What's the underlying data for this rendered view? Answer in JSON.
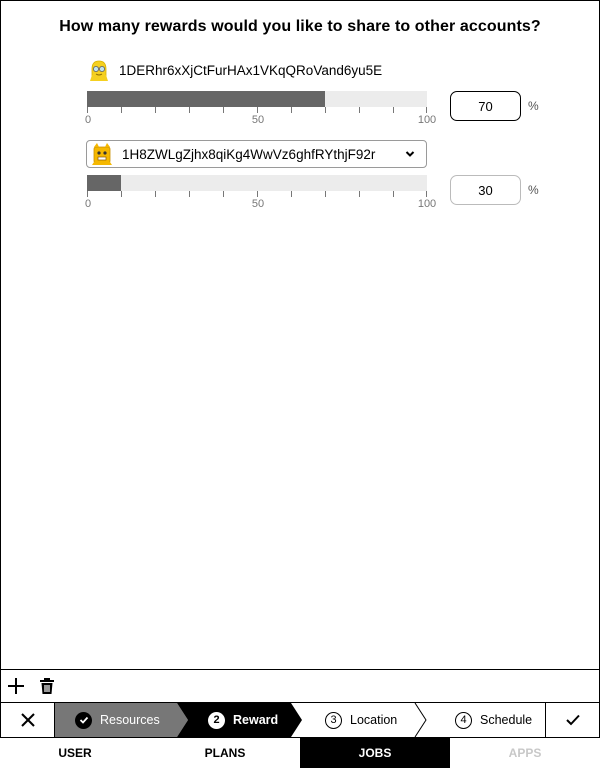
{
  "prompt": "How many rewards would you like to share to other accounts?",
  "accounts": [
    {
      "address": "1DERhr6xXjCtFurHAx1VKqQRoVand6yu5E",
      "value": "70",
      "fraction": 0.7,
      "avatar_icon": "yellow-face-glasses-icon"
    },
    {
      "address": "1H8ZWLgZjhx8qiKg4WwVz6ghfRYthjF92r",
      "value": "30",
      "fraction": 0.1,
      "avatar_icon": "yellow-monster-icon"
    }
  ],
  "scale": {
    "min": "0",
    "mid": "50",
    "max": "100"
  },
  "percent_sign": "%",
  "toolbar": {
    "add_icon": "plus-icon",
    "delete_icon": "trash-icon"
  },
  "steps": [
    {
      "num": "",
      "label": "Resources",
      "state": "done"
    },
    {
      "num": "2",
      "label": "Reward",
      "state": "current"
    },
    {
      "num": "3",
      "label": "Location",
      "state": "todo"
    },
    {
      "num": "4",
      "label": "Schedule",
      "state": "todo"
    }
  ],
  "tabs": [
    {
      "label": "USER",
      "state": "normal"
    },
    {
      "label": "PLANS",
      "state": "normal"
    },
    {
      "label": "JOBS",
      "state": "active"
    },
    {
      "label": "APPS",
      "state": "disabled"
    }
  ],
  "colors": {
    "fill": "#666666",
    "track": "#ececec",
    "step_done": "#777777",
    "step_current": "#000000"
  }
}
